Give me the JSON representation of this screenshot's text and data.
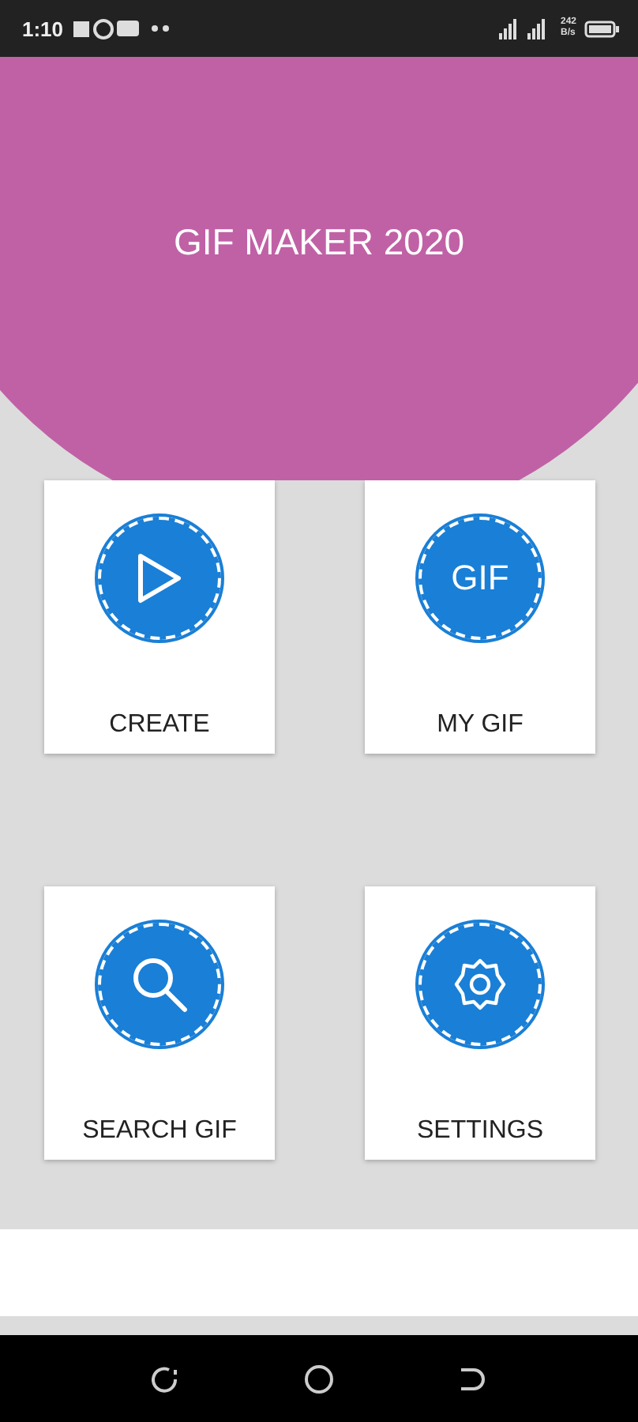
{
  "status_bar": {
    "time": "1:10",
    "speed_value": "242",
    "speed_unit": "B/s"
  },
  "header": {
    "title": "GIF MAKER 2020"
  },
  "menu": [
    {
      "label": "CREATE",
      "kind": "play"
    },
    {
      "label": "MY GIF",
      "kind": "text"
    },
    {
      "label": "SEARCH GIF",
      "kind": "search"
    },
    {
      "label": "SETTINGS",
      "kind": "settings"
    }
  ],
  "icon_texts": [
    "GIF"
  ]
}
